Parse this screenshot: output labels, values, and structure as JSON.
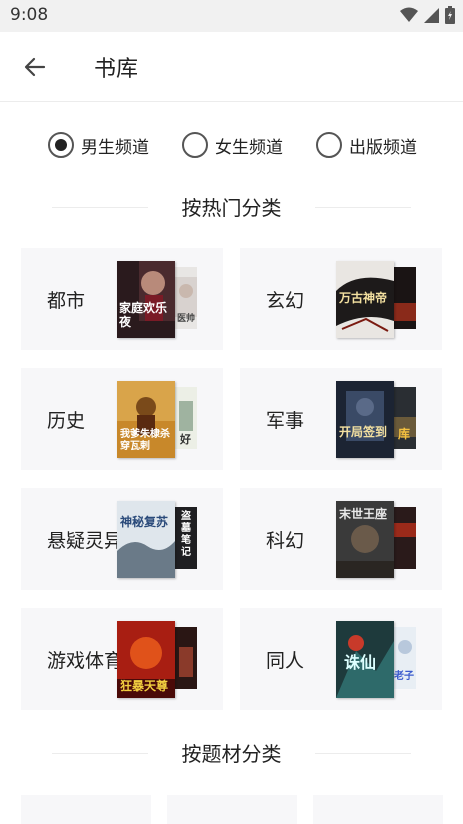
{
  "status_bar": {
    "time": "9:08"
  },
  "header": {
    "title": "书库"
  },
  "channels": [
    {
      "label": "男生频道",
      "checked": true
    },
    {
      "label": "女生频道",
      "checked": false
    },
    {
      "label": "出版频道",
      "checked": false
    }
  ],
  "sections": {
    "hot": "按热门分类",
    "theme": "按题材分类"
  },
  "categories": [
    {
      "label": "都市",
      "cover_front_text": "家庭欢乐夜",
      "cover_back_text": "医帅"
    },
    {
      "label": "玄幻",
      "cover_front_text": "万古神帝",
      "cover_back_text": ""
    },
    {
      "label": "历史",
      "cover_front_text": "我爹朱棣杀穿瓦剌",
      "cover_back_text": "好"
    },
    {
      "label": "军事",
      "cover_front_text": "开局签到",
      "cover_back_text": "库"
    },
    {
      "label": "悬疑灵异",
      "cover_front_text": "神秘复苏",
      "cover_back_text": "盗墓笔记"
    },
    {
      "label": "科幻",
      "cover_front_text": "末世王座",
      "cover_back_text": ""
    },
    {
      "label": "游戏体育",
      "cover_front_text": "狂暴天尊",
      "cover_back_text": ""
    },
    {
      "label": "同人",
      "cover_front_text": "诛仙",
      "cover_back_text": "老子"
    }
  ],
  "colors": {
    "card_bg": "#f7f7f9",
    "radio_border": "#555555",
    "divider": "#ececec"
  }
}
